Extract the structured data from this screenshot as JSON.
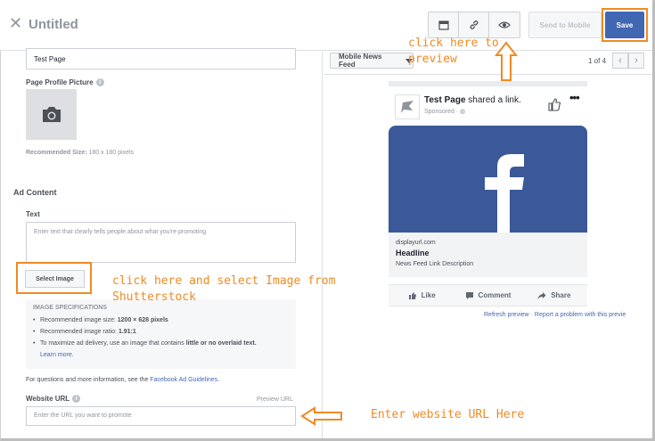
{
  "header": {
    "title": "Untitled",
    "send_to_mobile": "Send to Mobile",
    "save": "Save",
    "icons": [
      "close-icon",
      "card-icon",
      "link-icon",
      "eye-icon"
    ]
  },
  "left": {
    "page_name_value": "Test Page",
    "page_profile_label": "Page Profile Picture",
    "recommended_size_label": "Recommended Size:",
    "recommended_size_value": "180 x 180 pixels",
    "ad_content_title": "Ad Content",
    "text_label": "Text",
    "text_placeholder": "Enter text that clearly tells people about what you're promoting",
    "select_image": "Select Image",
    "specs": {
      "title": "IMAGE SPECIFICATIONS",
      "item1_prefix": "Recommended image size: ",
      "item1_value": "1200 × 628 pixels",
      "item2_prefix": "Recommended image ratio: ",
      "item2_value": "1.91:1",
      "item3_prefix": "To maximize ad delivery, use an image that contains ",
      "item3_bold": "little or no overlaid text.",
      "item3_link": "Learn more."
    },
    "questions_text": "For questions and more information, see the ",
    "questions_link": "Facebook Ad Guidelines",
    "questions_end": ".",
    "website_url_label": "Website URL",
    "preview_url": "Preview URL",
    "url_placeholder": "Enter the URL you want to promote"
  },
  "right": {
    "placement": "Mobile News Feed",
    "pager": "1 of 4",
    "prev": "‹",
    "next": "›",
    "card": {
      "page_name": "Test Page",
      "shared": " shared a link.",
      "sponsored": "Sponsored · ",
      "more": "•••",
      "domain": "displayurl.com",
      "headline": "Headline",
      "description": "News Feed Link Description",
      "like": "Like",
      "comment": "Comment",
      "share": "Share"
    },
    "refresh_preview": "Refresh preview",
    "separator": "·",
    "report_problem": "Report a problem with this previe"
  },
  "annotations": {
    "preview_line1": "click here to",
    "preview_line2": "preview",
    "select_line1": "click here and select Image from",
    "select_line2": "Shutterstock",
    "url_note": "Enter website URL Here"
  },
  "colors": {
    "accent_orange": "#f08a24",
    "facebook_blue": "#3b5998",
    "button_blue": "#4267b2"
  }
}
